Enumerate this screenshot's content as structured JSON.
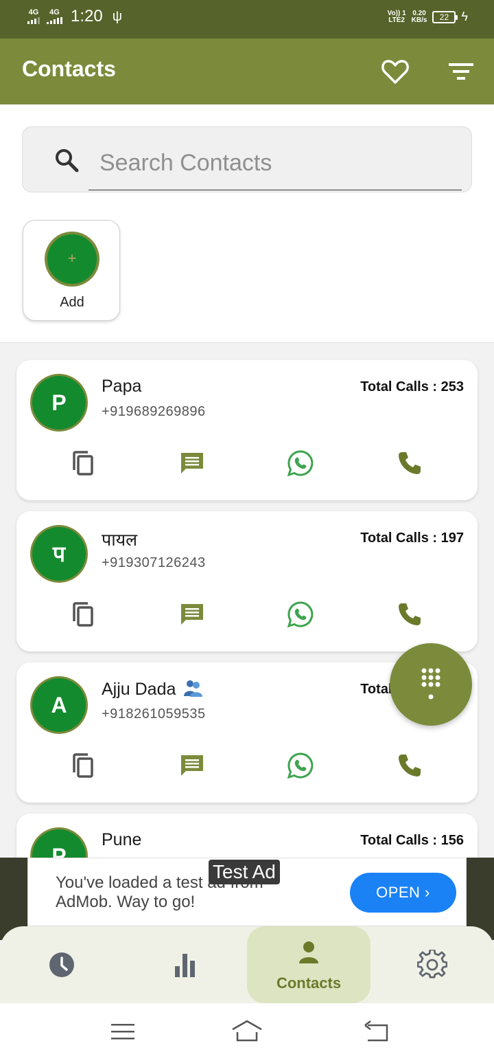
{
  "status_bar": {
    "net1": "4G",
    "net2": "4G",
    "time": "1:20",
    "volte": "Vo)) 1",
    "lte": "LTE2",
    "speed_value": "0.20",
    "speed_unit": "KB/s",
    "battery": "22"
  },
  "appbar": {
    "title": "Contacts"
  },
  "search": {
    "placeholder": "Search Contacts"
  },
  "add": {
    "label": "Add",
    "symbol": "+"
  },
  "contacts": [
    {
      "initial": "P",
      "name": "Papa",
      "phone": "+919689269896",
      "calls": "Total Calls : 253"
    },
    {
      "initial": "प",
      "name": "पायल",
      "phone": "+919307126243",
      "calls": "Total Calls : 197"
    },
    {
      "initial": "A",
      "name": "Ajju Dada",
      "phone": "+918261059535",
      "calls": "Total Calls : 195"
    },
    {
      "initial": "P",
      "name": "Pune",
      "phone": "",
      "calls": "Total Calls : 156"
    }
  ],
  "ad": {
    "tag": "Test Ad",
    "text": "You've loaded a test ad from AdMob. Way to go!",
    "button": "OPEN ›"
  },
  "bottom_nav": {
    "items": [
      "recents-icon",
      "stats-icon",
      "contacts-icon",
      "settings-icon"
    ],
    "active_label": "Contacts"
  },
  "colors": {
    "brand": "#7b8b3b",
    "status_bar": "#56632a",
    "avatar": "#138a2e",
    "ad_button": "#1a82f5"
  }
}
